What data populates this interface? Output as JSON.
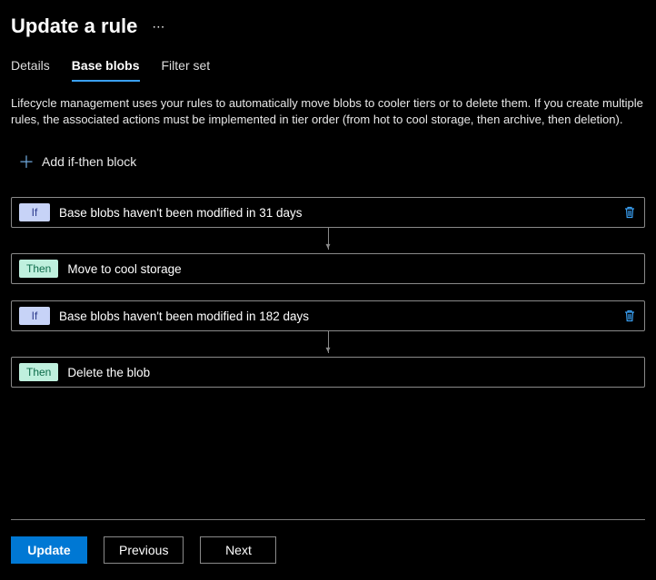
{
  "header": {
    "title": "Update a rule",
    "more_label": "⋯"
  },
  "tabs": [
    {
      "label": "Details",
      "active": false
    },
    {
      "label": "Base blobs",
      "active": true
    },
    {
      "label": "Filter set",
      "active": false
    }
  ],
  "description": "Lifecycle management uses your rules to automatically move blobs to cooler tiers or to delete them. If you create multiple rules, the associated actions must be implemented in tier order (from hot to cool storage, then archive, then deletion).",
  "add_block_label": "Add if-then block",
  "badges": {
    "if": "If",
    "then": "Then"
  },
  "blocks": [
    {
      "if_text": "Base blobs haven't been modified in 31 days",
      "then_text": "Move to cool storage"
    },
    {
      "if_text": "Base blobs haven't been modified in 182 days",
      "then_text": "Delete the blob"
    }
  ],
  "footer": {
    "update": "Update",
    "previous": "Previous",
    "next": "Next"
  }
}
